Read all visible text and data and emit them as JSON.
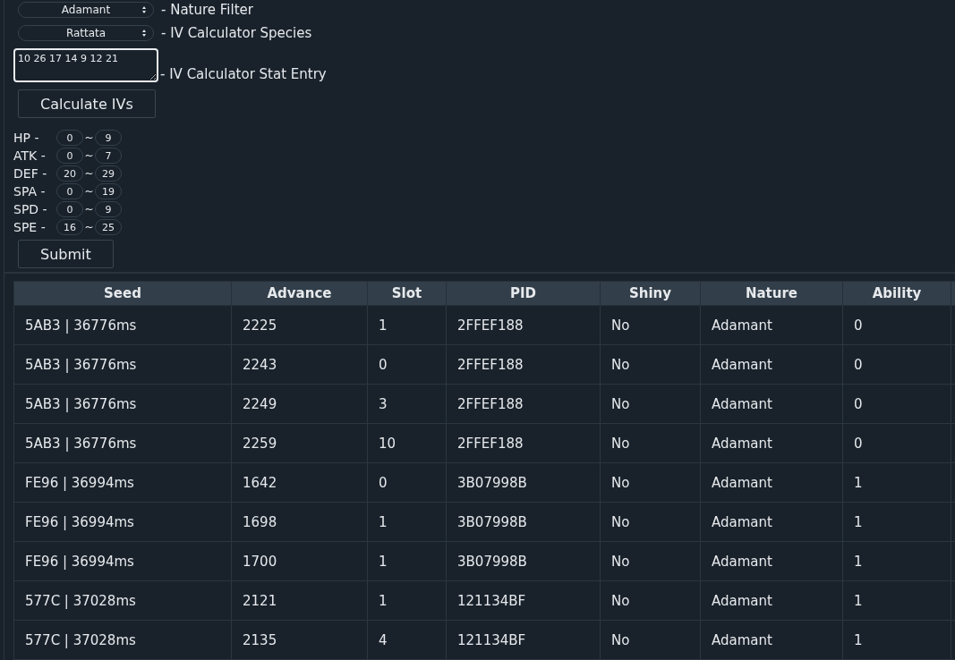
{
  "nature_filter": {
    "value": "Adamant",
    "label": "- Nature Filter"
  },
  "species": {
    "value": "Rattata",
    "label": "- IV Calculator Species"
  },
  "stat_entry": {
    "value": "10 26 17 14 9 12 21",
    "label": "- IV Calculator Stat Entry"
  },
  "calculate_button": "Calculate IVs",
  "iv_ranges": [
    {
      "stat": "HP -",
      "min": "0",
      "max": "9"
    },
    {
      "stat": "ATK -",
      "min": "0",
      "max": "7"
    },
    {
      "stat": "DEF -",
      "min": "20",
      "max": "29"
    },
    {
      "stat": "SPA -",
      "min": "0",
      "max": "19"
    },
    {
      "stat": "SPD -",
      "min": "0",
      "max": "9"
    },
    {
      "stat": "SPE -",
      "min": "16",
      "max": "25"
    }
  ],
  "range_separator": "~",
  "submit_button": "Submit",
  "table": {
    "columns": [
      "Seed",
      "Advance",
      "Slot",
      "PID",
      "Shiny",
      "Nature",
      "Ability"
    ],
    "rows": [
      [
        "5AB3 | 36776ms",
        "2225",
        "1",
        "2FFEF188",
        "No",
        "Adamant",
        "0"
      ],
      [
        "5AB3 | 36776ms",
        "2243",
        "0",
        "2FFEF188",
        "No",
        "Adamant",
        "0"
      ],
      [
        "5AB3 | 36776ms",
        "2249",
        "3",
        "2FFEF188",
        "No",
        "Adamant",
        "0"
      ],
      [
        "5AB3 | 36776ms",
        "2259",
        "10",
        "2FFEF188",
        "No",
        "Adamant",
        "0"
      ],
      [
        "FE96 | 36994ms",
        "1642",
        "0",
        "3B07998B",
        "No",
        "Adamant",
        "1"
      ],
      [
        "FE96 | 36994ms",
        "1698",
        "1",
        "3B07998B",
        "No",
        "Adamant",
        "1"
      ],
      [
        "FE96 | 36994ms",
        "1700",
        "1",
        "3B07998B",
        "No",
        "Adamant",
        "1"
      ],
      [
        "577C | 37028ms",
        "2121",
        "1",
        "121134BF",
        "No",
        "Adamant",
        "1"
      ],
      [
        "577C | 37028ms",
        "2135",
        "4",
        "121134BF",
        "No",
        "Adamant",
        "1"
      ]
    ]
  }
}
